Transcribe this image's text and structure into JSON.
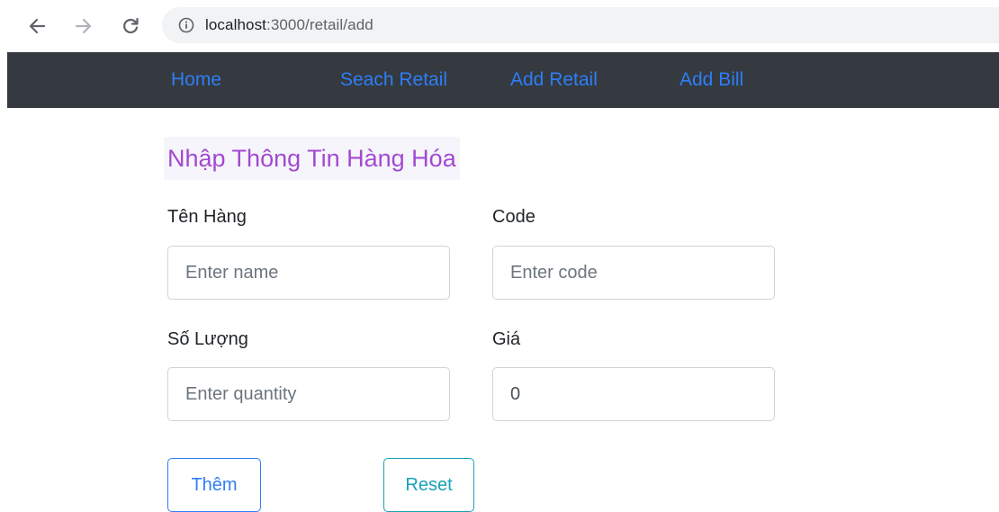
{
  "browser": {
    "url_host": "localhost",
    "url_path": ":3000/retail/add",
    "icons": {
      "back": "arrow-left-icon",
      "forward": "arrow-right-icon",
      "reload": "reload-icon",
      "info": "info-icon"
    }
  },
  "navbar": {
    "background": "#343a40",
    "link_color": "#2f7df6",
    "items": [
      {
        "label": "Home"
      },
      {
        "label": "Seach Retail"
      },
      {
        "label": "Add Retail"
      },
      {
        "label": "Add Bill"
      }
    ]
  },
  "form": {
    "title": "Nhập Thông Tin Hàng Hóa",
    "title_color": "#a349d1",
    "fields": {
      "name": {
        "label": "Tên Hàng",
        "placeholder": "Enter name",
        "value": ""
      },
      "code": {
        "label": "Code",
        "placeholder": "Enter code",
        "value": ""
      },
      "quantity": {
        "label": "Số Lượng",
        "placeholder": "Enter quantity",
        "value": ""
      },
      "price": {
        "label": "Giá",
        "placeholder": "",
        "value": "0"
      }
    },
    "buttons": {
      "add_label": "Thêm",
      "add_color": "#2f7df6",
      "reset_label": "Reset",
      "reset_color": "#17a2b8"
    }
  }
}
